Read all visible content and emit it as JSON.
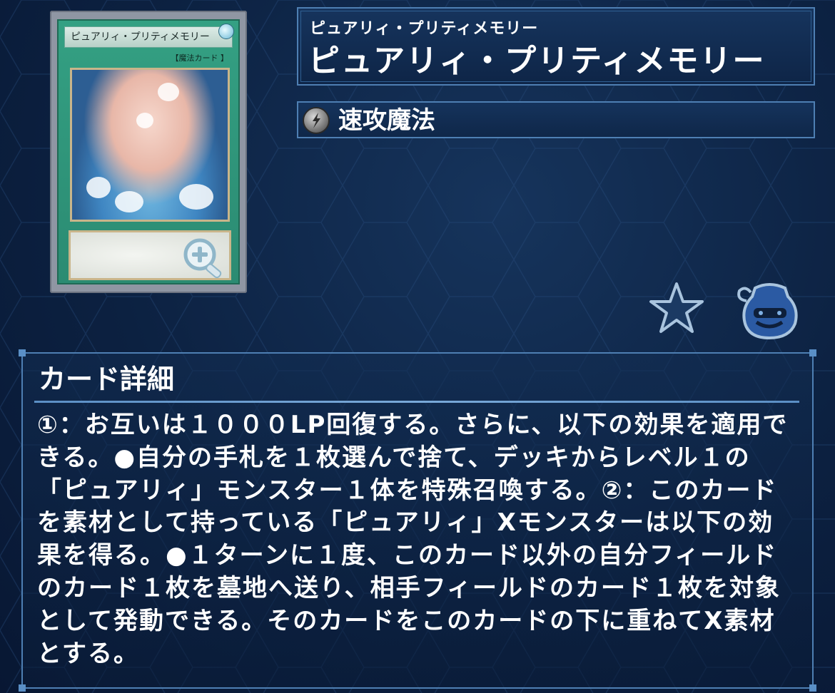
{
  "card": {
    "image_name_label": "ピュアリィ・プリティメモリー",
    "image_type_line": "【魔法カード  】",
    "zoom_icon": "zoom-in-icon"
  },
  "name": {
    "ruby": "ピュアリィ・プリティメモリー",
    "main": "ピュアリィ・プリティメモリー"
  },
  "type": {
    "icon": "quick-play-icon",
    "label": "速攻魔法"
  },
  "actions": {
    "favorite_icon": "star-icon",
    "deck_icon": "pot-of-greed-icon"
  },
  "detail": {
    "title": "カード詳細",
    "text": "①：お互いは１０００LP回復する。さらに、以下の効果を適用できる。●自分の手札を１枚選んで捨て、デッキからレベル１の「ピュアリィ」モンスター１体を特殊召喚する。②：このカードを素材として持っている「ピュアリィ」Xモンスターは以下の効果を得る。●１ターンに１度、このカード以外の自分フィールドのカード１枚を墓地へ送り、相手フィールドのカード１枚を対象として発動できる。そのカードをこのカードの下に重ねてX素材とする。"
  },
  "colors": {
    "background": "#0c2141",
    "panel_border": "#4e7fb3",
    "spell_card_green": "#2b8b72",
    "text": "#ffffff"
  }
}
